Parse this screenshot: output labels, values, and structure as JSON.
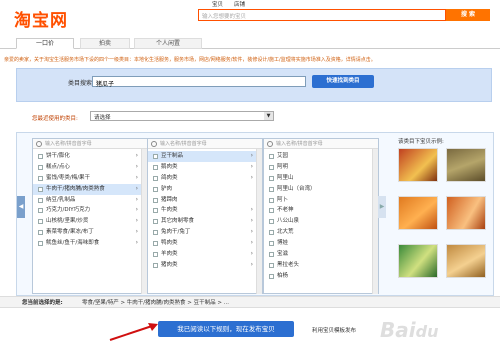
{
  "header": {
    "logo": "淘宝网",
    "search_tabs": [
      "宝贝",
      "店铺"
    ],
    "search_placeholder": "输入您想要的宝贝",
    "search_button": "搜 索"
  },
  "tabs": [
    {
      "label": "一口价",
      "active": true
    },
    {
      "label": "拍卖",
      "active": false
    },
    {
      "label": "个人闲置",
      "active": false
    }
  ],
  "notice": "亲爱的卖家，关于淘宝生活服务市场下设的四个一级类目：本地化生活服务，服务市场，网店/网络服务/软件，装修设计/施工/监理将实施市场准入及资格，详情请点击。",
  "category_search": {
    "label": "类目搜索:",
    "value": "猪瓜子",
    "button": "快速找到类目"
  },
  "recent": {
    "label": "您最近使用的类目:",
    "value": "请选择"
  },
  "columns": [
    {
      "placeholder": "输入名称/拼音首字母",
      "items": [
        {
          "label": "饼干/膨化",
          "arrow": true,
          "selected": false
        },
        {
          "label": "糕点/点心",
          "arrow": true,
          "selected": false
        },
        {
          "label": "蜜饯/枣类/梅/果干",
          "arrow": true,
          "selected": false
        },
        {
          "label": "牛肉干/猪肉脯/肉类熟食",
          "arrow": true,
          "selected": true
        },
        {
          "label": "纳豆/乳制品",
          "arrow": true,
          "selected": false
        },
        {
          "label": "巧克力/DIY巧克力",
          "arrow": true,
          "selected": false
        },
        {
          "label": "山核桃/坚果/炒货",
          "arrow": true,
          "selected": false
        },
        {
          "label": "素菜零食/果冻/布丁",
          "arrow": true,
          "selected": false
        },
        {
          "label": "鱿鱼丝/鱼干/海味即食",
          "arrow": true,
          "selected": false
        }
      ]
    },
    {
      "placeholder": "输入名称/拼音首字母",
      "items": [
        {
          "label": "豆干制品",
          "arrow": true,
          "selected": true
        },
        {
          "label": "鹅肉类",
          "arrow": true,
          "selected": false
        },
        {
          "label": "鸽肉类",
          "arrow": true,
          "selected": false
        },
        {
          "label": "驴肉",
          "arrow": false,
          "selected": false
        },
        {
          "label": "猪蹄肉",
          "arrow": false,
          "selected": false
        },
        {
          "label": "牛肉类",
          "arrow": true,
          "selected": false
        },
        {
          "label": "其它肉制零食",
          "arrow": true,
          "selected": false
        },
        {
          "label": "兔肉干/兔丁",
          "arrow": true,
          "selected": false
        },
        {
          "label": "鸭肉类",
          "arrow": true,
          "selected": false
        },
        {
          "label": "羊肉类",
          "arrow": true,
          "selected": false
        },
        {
          "label": "猪肉类",
          "arrow": true,
          "selected": false
        }
      ]
    },
    {
      "placeholder": "输入名称/拼音首字母",
      "items": [
        {
          "label": "艾园",
          "arrow": false,
          "selected": false
        },
        {
          "label": "阿明",
          "arrow": false,
          "selected": false
        },
        {
          "label": "阿里山",
          "arrow": false,
          "selected": false
        },
        {
          "label": "阿里山（台湾）",
          "arrow": false,
          "selected": false
        },
        {
          "label": "阿卜",
          "arrow": false,
          "selected": false
        },
        {
          "label": "不老神",
          "arrow": false,
          "selected": false
        },
        {
          "label": "八公山泉",
          "arrow": false,
          "selected": false
        },
        {
          "label": "北大荒",
          "arrow": false,
          "selected": false
        },
        {
          "label": "博娃",
          "arrow": false,
          "selected": false
        },
        {
          "label": "宝滋",
          "arrow": false,
          "selected": false
        },
        {
          "label": "黑拉老头",
          "arrow": false,
          "selected": false
        },
        {
          "label": "柏杨",
          "arrow": false,
          "selected": false
        }
      ]
    }
  ],
  "examples_title": "该类目下宝贝示例:",
  "selected_path": {
    "label": "您当前选择的是:",
    "value": "零食/坚果/特产 > 牛肉干/猪肉脯/肉类熟食 > 豆干制品 > ..."
  },
  "publish_button": "我已阅读以下规则，现在发布宝贝",
  "template_link": "利用宝贝模板发布",
  "watermark": "Baidu经验"
}
